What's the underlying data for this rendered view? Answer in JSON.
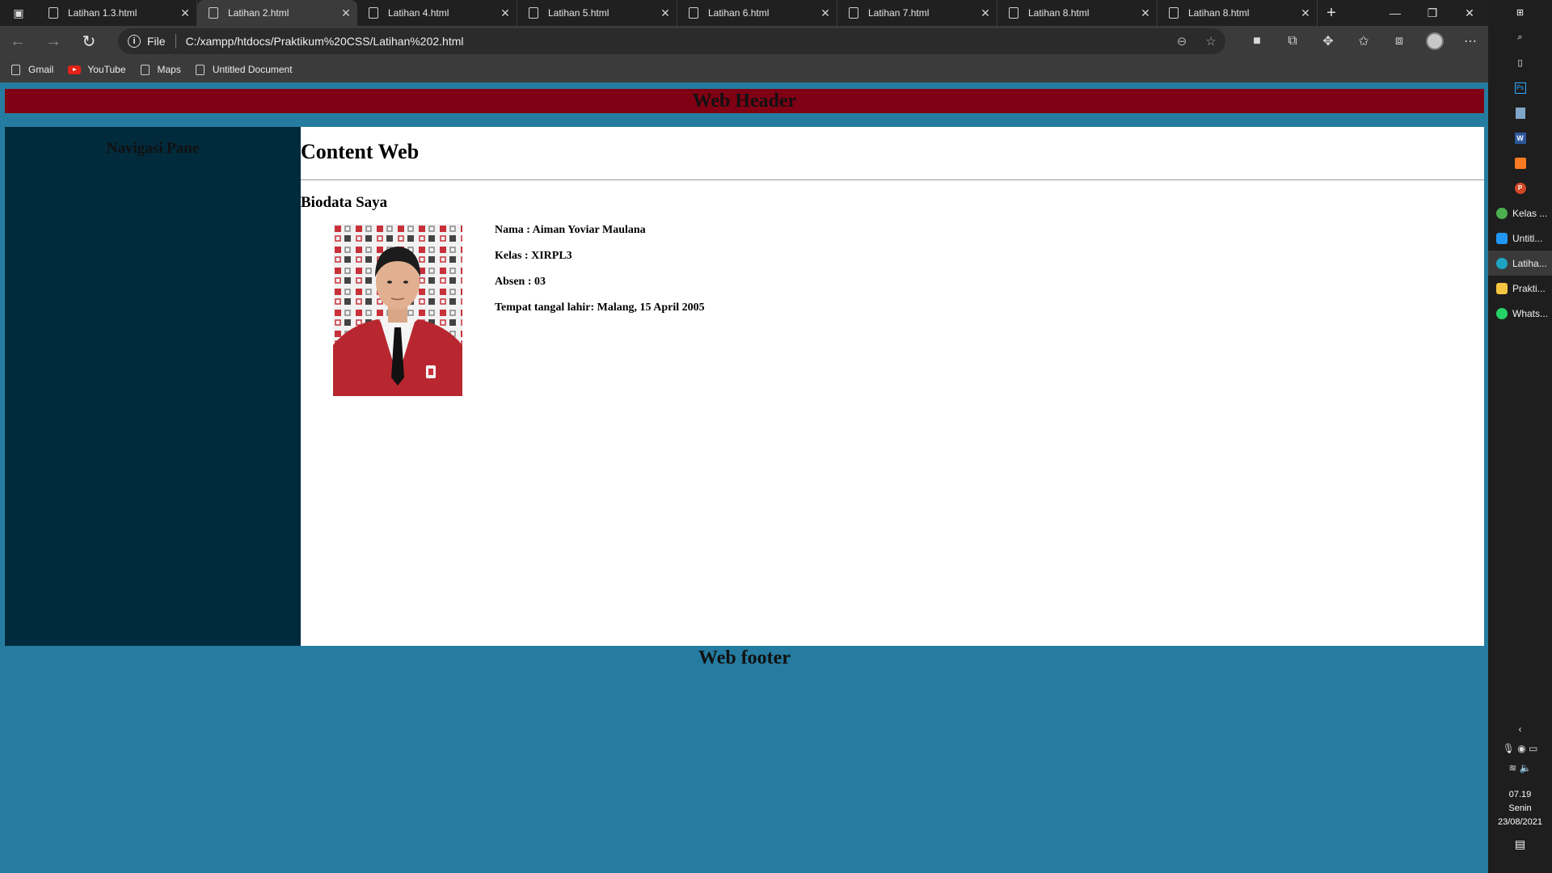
{
  "browser": {
    "tabs": [
      {
        "title": "Latihan 1.3.html",
        "active": false
      },
      {
        "title": "Latihan 2.html",
        "active": true
      },
      {
        "title": "Latihan 4.html",
        "active": false
      },
      {
        "title": "Latihan 5.html",
        "active": false
      },
      {
        "title": "Latihan 6.html",
        "active": false
      },
      {
        "title": "Latihan 7.html",
        "active": false
      },
      {
        "title": "Latihan 8.html",
        "active": false
      },
      {
        "title": "Latihan 8.html",
        "active": false
      }
    ],
    "address": {
      "scheme": "File",
      "url": "C:/xampp/htdocs/Praktikum%20CSS/Latihan%202.html"
    },
    "bookmarks": [
      {
        "label": "Gmail",
        "icon": "page-icon"
      },
      {
        "label": "YouTube",
        "icon": "youtube-icon"
      },
      {
        "label": "Maps",
        "icon": "page-icon"
      },
      {
        "label": "Untitled Document",
        "icon": "page-icon"
      }
    ]
  },
  "page": {
    "header": "Web Header",
    "nav_title": "Navigasi Pane",
    "content_title": "Content Web",
    "section_title": "Biodata Saya",
    "bio": {
      "nama": "Nama : Aiman Yoviar Maulana",
      "kelas": "Kelas : XIRPL3",
      "absen": "Absen : 03",
      "ttl": "Tempat tangal lahir: Malang, 15 April 2005"
    },
    "footer": "Web footer",
    "colors": {
      "header_bg": "#800014",
      "nav_bg": "#012b3c",
      "page_bg": "#257ca0"
    }
  },
  "taskbar": {
    "apps": [
      {
        "label": "Kelas ...",
        "color": "#4caf50",
        "active": false
      },
      {
        "label": "Untitl...",
        "color": "#2196f3",
        "active": false
      },
      {
        "label": "Latiha...",
        "color": "#1fa3c4",
        "active": true
      },
      {
        "label": "Prakti...",
        "color": "#f5c542",
        "active": false
      },
      {
        "label": "Whats...",
        "color": "#25d366",
        "active": false
      }
    ],
    "time": "07.19",
    "day": "Senin",
    "date": "23/08/2021"
  }
}
